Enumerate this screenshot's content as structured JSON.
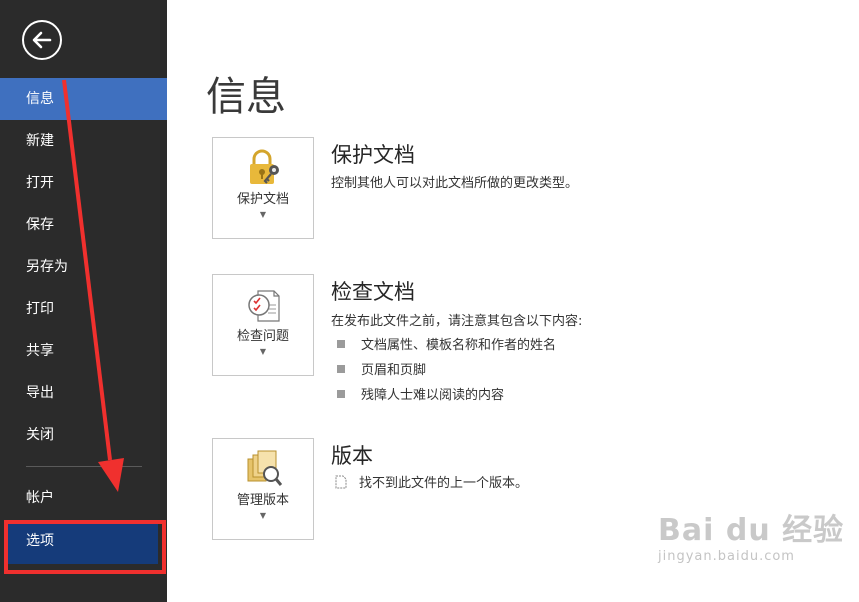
{
  "sidebar": {
    "items": [
      {
        "label": "信息"
      },
      {
        "label": "新建"
      },
      {
        "label": "打开"
      },
      {
        "label": "保存"
      },
      {
        "label": "另存为"
      },
      {
        "label": "打印"
      },
      {
        "label": "共享"
      },
      {
        "label": "导出"
      },
      {
        "label": "关闭"
      },
      {
        "label": "帐户"
      },
      {
        "label": "选项"
      }
    ]
  },
  "main": {
    "title": "信息",
    "sections": [
      {
        "button_label": "保护文档",
        "icon": "lock-key-icon",
        "title": "保护文档",
        "description": "控制其他人可以对此文档所做的更改类型。"
      },
      {
        "button_label": "检查问题",
        "icon": "inspect-document-icon",
        "title": "检查文档",
        "description": "在发布此文件之前，请注意其包含以下内容:",
        "bullets": [
          "文档属性、模板名称和作者的姓名",
          "页眉和页脚",
          "残障人士难以阅读的内容"
        ]
      },
      {
        "button_label": "管理版本",
        "icon": "manage-versions-icon",
        "title": "版本",
        "description": "找不到此文件的上一个版本。"
      }
    ]
  },
  "watermark": {
    "brand": "Bai du 经验",
    "url": "jingyan.baidu.com"
  },
  "colors": {
    "sidebar_bg": "#2b2b2b",
    "active_item": "#3f70bf",
    "highlight_red": "#f0302e"
  }
}
